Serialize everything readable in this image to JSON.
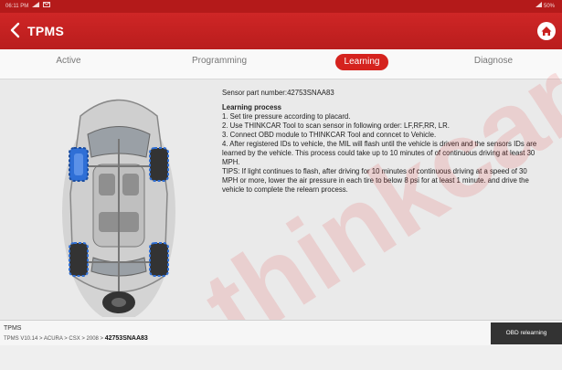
{
  "status_bar": {
    "time": "06:11 PM",
    "battery": "50%",
    "icons": [
      "signal-icon",
      "wifi-icon",
      "mail-icon",
      "battery-icon"
    ]
  },
  "header": {
    "title": "TPMS",
    "back_icon": "chevron-left-icon",
    "home_icon": "home-icon"
  },
  "tabs": [
    {
      "label": "Active",
      "active": false
    },
    {
      "label": "Programming",
      "active": false
    },
    {
      "label": "Learning",
      "active": true
    },
    {
      "label": "Diagnose",
      "active": false
    }
  ],
  "content": {
    "sensor_part": "Sensor part number:42753SNAA83",
    "heading": "Learning process",
    "steps": [
      "1. Set tire pressure according to placard.",
      "2. Use THINKCAR Tool to scan sensor in following order: LF,RF,RR, LR.",
      "3. Connect OBD module to THINKCAR Tool and conncet to Vehicle.",
      "4. After registered IDs to vehicle, the MIL will flash until the vehicle is driven and the sensors IDs are learned by the vehicle. This process could take up to 10 minutes of of continuous driving at least 30 MPH.",
      "TIPS: If light continues to flash, after driving for 10 minutes of continuous driving at a speed of 30 MPH or more, lower the air pressure in each tire to below 8 psi for at least 1 minute.  and drive the vehicle to complete the relearn process."
    ]
  },
  "footer": {
    "title": "TPMS",
    "breadcrumb": "TPMS V10.14 > ACURA > CSX > 2008 >",
    "part_number": "42753SNAA83",
    "action_button": "OBD relearning"
  },
  "watermark": "thinkcar",
  "colors": {
    "brand_red": "#c9211f",
    "active_tab": "#d5231e",
    "sensor_blue": "#2f6fd6"
  }
}
